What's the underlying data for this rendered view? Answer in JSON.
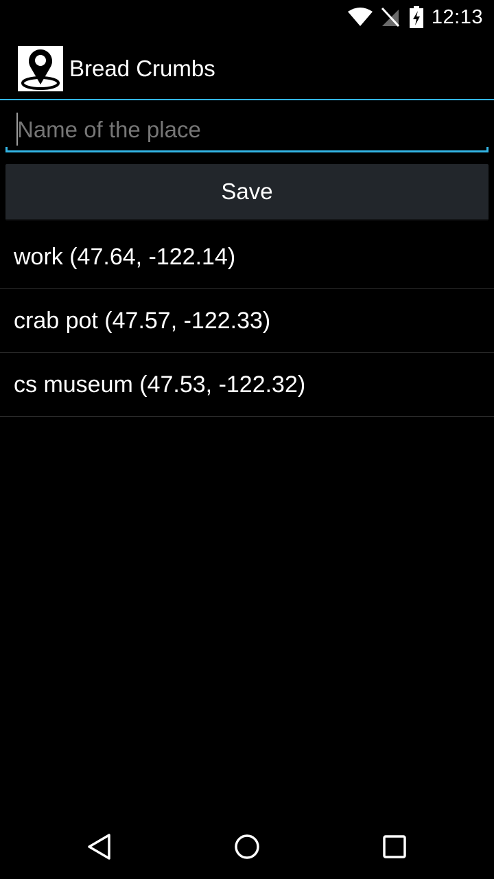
{
  "status_bar": {
    "time": "12:13",
    "icons": [
      "wifi-icon",
      "no-sim-icon",
      "battery-charging-icon"
    ]
  },
  "action_bar": {
    "icon": "map-pin-icon",
    "title": "Bread Crumbs"
  },
  "form": {
    "name_value": "",
    "name_placeholder": "Name of the place",
    "save_label": "Save"
  },
  "places": [
    {
      "label": "work (47.64, -122.14)"
    },
    {
      "label": "crab pot (47.57, -122.33)"
    },
    {
      "label": "cs museum (47.53, -122.32)"
    }
  ],
  "nav_bar": {
    "buttons": [
      "back-icon",
      "home-icon",
      "recents-icon"
    ]
  },
  "colors": {
    "accent": "#33b5e5",
    "background": "#000000",
    "button": "#22262b"
  }
}
